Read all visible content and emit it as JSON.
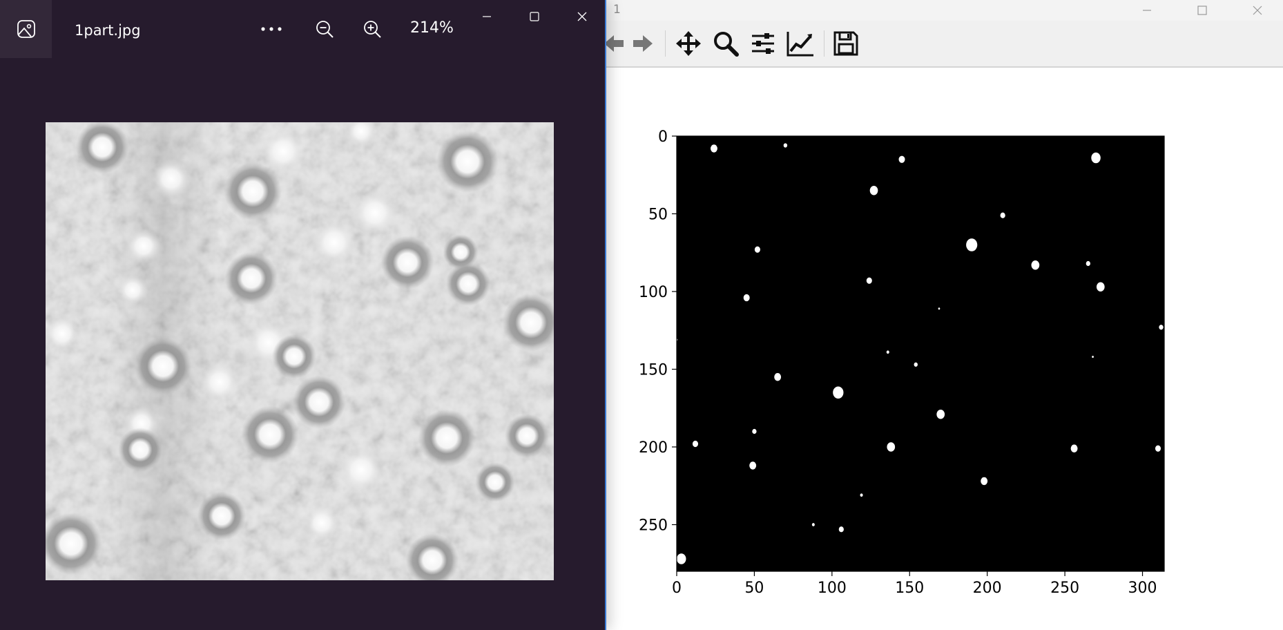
{
  "figure_window": {
    "title": "1",
    "controls": [
      "minimize-icon",
      "maximize-icon",
      "close-icon"
    ],
    "toolbar": [
      "back-icon",
      "forward-icon",
      "pan-icon",
      "zoom-icon",
      "configure-subplots-icon",
      "edit-axes-icon",
      "save-icon"
    ]
  },
  "photos": {
    "file_name": "1part.jpg",
    "zoom": "214%",
    "buttons": [
      "more-icon",
      "zoom-out-icon",
      "zoom-in-icon"
    ],
    "window_controls": [
      "minimize-icon",
      "maximize-icon",
      "close-icon"
    ]
  },
  "chart_data": {
    "type": "image",
    "title": "",
    "xlabel": "",
    "ylabel": "",
    "xlim": [
      0,
      314
    ],
    "ylim": [
      280,
      0
    ],
    "xticks": [
      0,
      50,
      100,
      150,
      200,
      250,
      300
    ],
    "yticks": [
      0,
      50,
      100,
      150,
      200,
      250
    ],
    "background": "#000000",
    "blob_color": "#ffffff",
    "blobs": [
      [
        24,
        8,
        2.2
      ],
      [
        70,
        6,
        1.2
      ],
      [
        145,
        15,
        2.0
      ],
      [
        270,
        14,
        3.0
      ],
      [
        127,
        35,
        2.6
      ],
      [
        210,
        51,
        1.6
      ],
      [
        190,
        70,
        3.6
      ],
      [
        52,
        73,
        1.8
      ],
      [
        231,
        83,
        2.6
      ],
      [
        265,
        82,
        1.4
      ],
      [
        124,
        93,
        1.8
      ],
      [
        45,
        104,
        2.0
      ],
      [
        273,
        97,
        2.6
      ],
      [
        169,
        111,
        0.6
      ],
      [
        312,
        123,
        1.4
      ],
      [
        0,
        131,
        0.6
      ],
      [
        136,
        139,
        0.9
      ],
      [
        154,
        147,
        1.2
      ],
      [
        268,
        142,
        0.6
      ],
      [
        65,
        155,
        2.2
      ],
      [
        104,
        165,
        3.4
      ],
      [
        170,
        179,
        2.6
      ],
      [
        50,
        190,
        1.4
      ],
      [
        12,
        198,
        1.8
      ],
      [
        138,
        200,
        2.6
      ],
      [
        256,
        201,
        2.2
      ],
      [
        310,
        201,
        1.8
      ],
      [
        49,
        212,
        2.2
      ],
      [
        198,
        222,
        2.2
      ],
      [
        119,
        231,
        0.9
      ],
      [
        88,
        250,
        0.9
      ],
      [
        106,
        253,
        1.6
      ],
      [
        3,
        272,
        3.0
      ]
    ]
  }
}
